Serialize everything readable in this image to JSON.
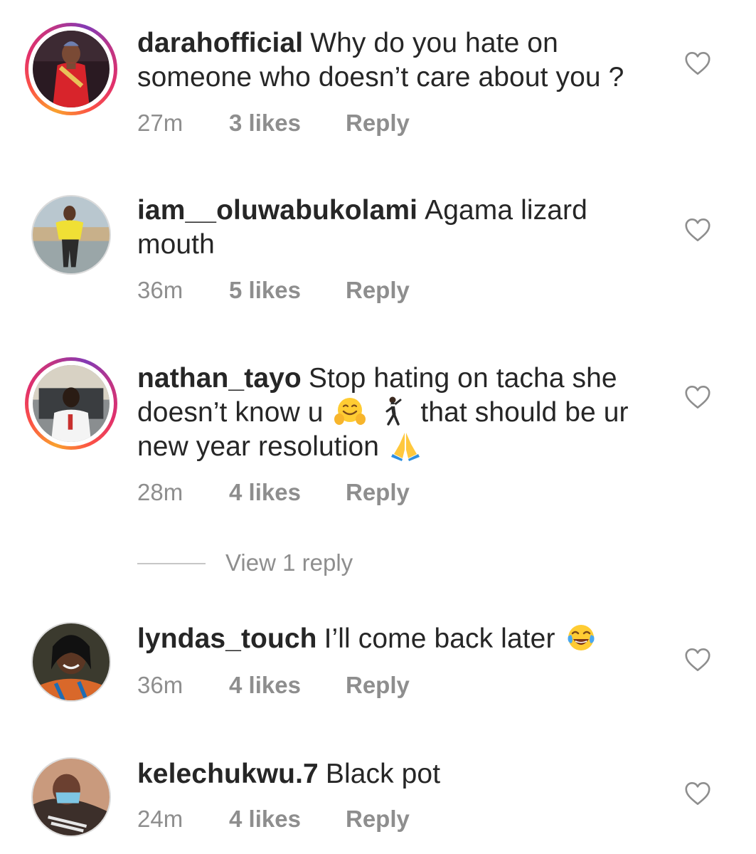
{
  "comments": [
    {
      "username": "darahofficial",
      "text": "Why do you hate on someone who doesn’t care about you ?",
      "time": "27m",
      "likes": "3 likes",
      "reply": "Reply",
      "avatar_ring": "story"
    },
    {
      "username": "iam__oluwabukolami",
      "text": "Agama lizard mouth",
      "time": "36m",
      "likes": "5 likes",
      "reply": "Reply",
      "avatar_ring": "none"
    },
    {
      "username": "nathan_tayo",
      "text_line1": "Stop hating on tacha she",
      "text_line2a": "doesn’t know u",
      "text_line2b": "that should be ur",
      "text_line3": "new year resolution",
      "emojis": [
        "hugging-face-emoji",
        "man-dancing-emoji",
        "folded-hands-emoji"
      ],
      "time": "28m",
      "likes": "4 likes",
      "reply": "Reply",
      "avatar_ring": "story",
      "view_replies": "View 1 reply"
    },
    {
      "username": "lyndas_touch",
      "text": "I’ll come back later",
      "emojis": [
        "face-with-tears-of-joy-emoji"
      ],
      "time": "36m",
      "likes": "4 likes",
      "reply": "Reply",
      "avatar_ring": "none"
    },
    {
      "username": "kelechukwu.7",
      "text": "Black pot",
      "time": "24m",
      "likes": "4 likes",
      "reply": "Reply",
      "avatar_ring": "none"
    }
  ],
  "colors": {
    "text": "#262626",
    "meta": "#8e8e8e",
    "heart_outline": "#8e8e8e",
    "divider": "#c7c7c7"
  }
}
